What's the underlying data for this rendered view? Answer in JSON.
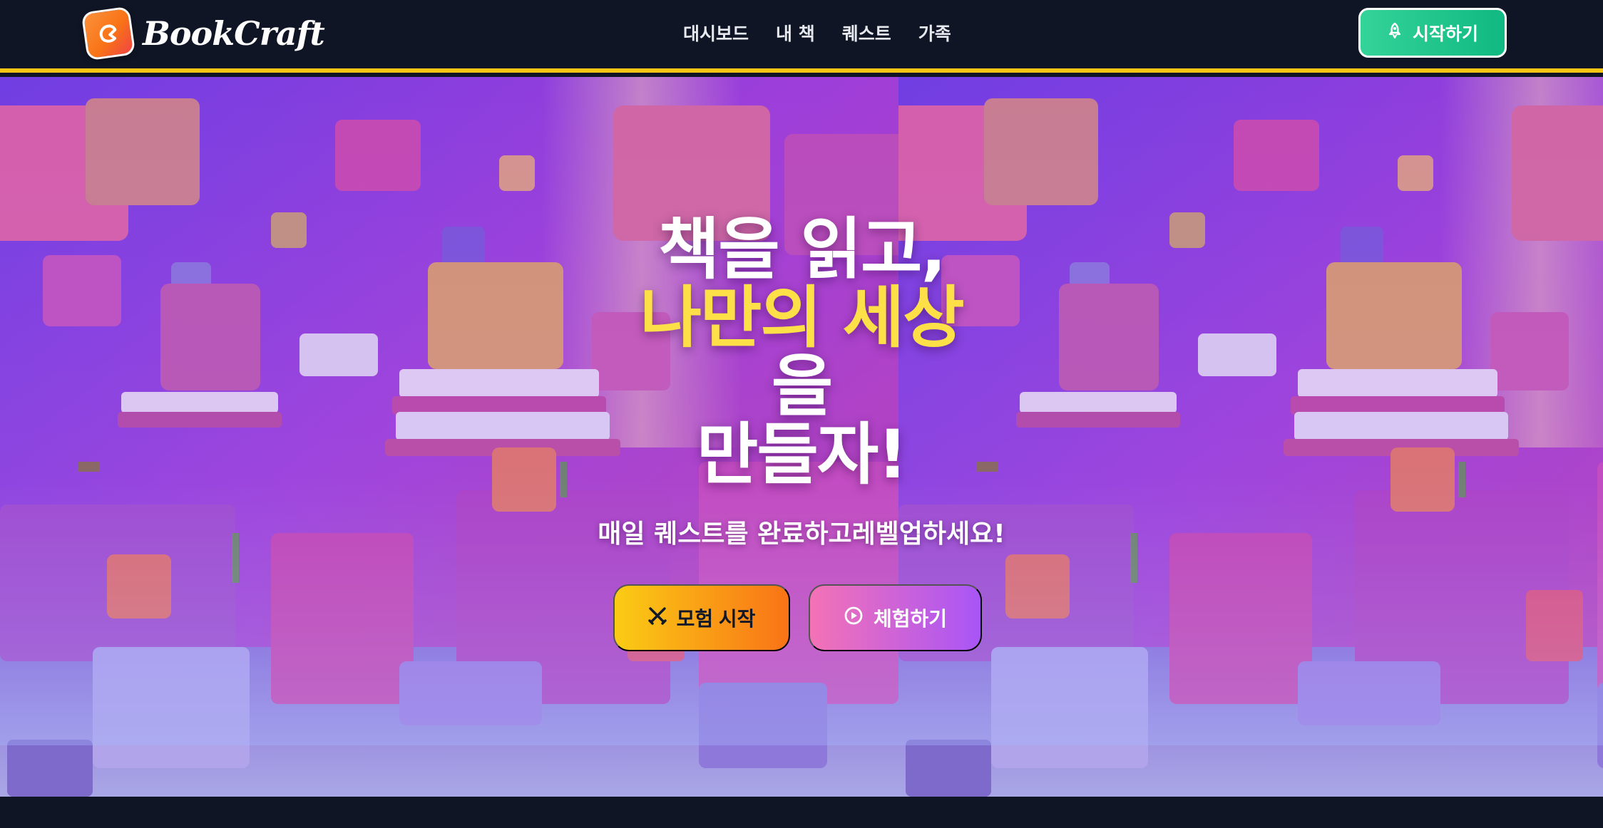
{
  "brand": {
    "name": "BookCraft",
    "accent": "#fcc614"
  },
  "nav": {
    "links": [
      "대시보드",
      "내 책",
      "퀘스트",
      "가족"
    ],
    "start_label": "시작하기",
    "start_icon": "rocket-icon"
  },
  "hero": {
    "headline_line1": "책을 읽고,",
    "headline_line2": "나만의 세상",
    "headline_line3": "을",
    "headline_line4": "만들자!",
    "subtitle": "매일 퀘스트를 완료하고레벨업하세요!",
    "primary_cta": {
      "label": "모험 시작",
      "icon": "crossed-swords-icon"
    },
    "secondary_cta": {
      "label": "체험하기",
      "icon": "play-circle-icon"
    }
  },
  "colors": {
    "nav_bg": "#0f1525",
    "start_button": "#10b981",
    "headline_highlight": "#fde047",
    "cta_primary": "#f97316",
    "cta_secondary": "#a855f7"
  }
}
